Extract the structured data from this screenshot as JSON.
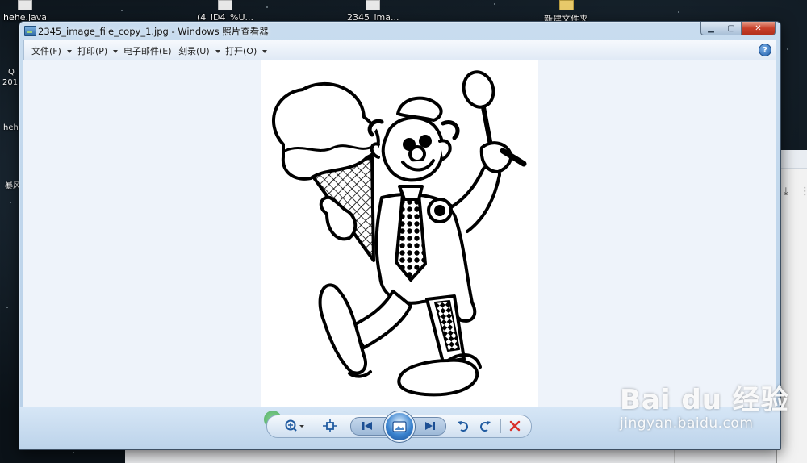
{
  "desktop": {
    "icons": [
      {
        "label": "hehe.java"
      },
      {
        "label": "(4_ID4_%U..."
      },
      {
        "label": "2345_ima..."
      },
      {
        "label": "新建文件夹"
      }
    ],
    "left_fragments": [
      "Q",
      "201",
      "hehe",
      "暴风"
    ]
  },
  "window": {
    "title": "2345_image_file_copy_1.jpg - Windows 照片查看器",
    "app_icon": "photo-viewer-icon",
    "caption_buttons": {
      "minimize": "minimize-icon",
      "maximize": "maximize-icon",
      "close": "close-icon"
    }
  },
  "menubar": {
    "items": [
      {
        "label": "文件(F)"
      },
      {
        "label": "打印(P)"
      },
      {
        "label": "电子邮件(E)"
      },
      {
        "label": "刻录(U)"
      },
      {
        "label": "打开(O)"
      }
    ],
    "help_icon": "help-icon",
    "help_label": "?"
  },
  "image": {
    "description_icon": "clown-ice-cream-cartoon"
  },
  "controls": {
    "zoom_icon": "zoom-icon",
    "fit_icon": "actual-size-icon",
    "prev_icon": "previous-icon",
    "slideshow_icon": "slideshow-icon",
    "next_icon": "next-icon",
    "rotate_ccw_icon": "rotate-counterclockwise-icon",
    "rotate_cw_icon": "rotate-clockwise-icon",
    "delete_icon": "delete-icon"
  },
  "watermark": {
    "logo": "Bai du 经验",
    "url": "jingyan.baidu.com"
  },
  "colors": {
    "window_frame": "#c8dcef",
    "viewer_bg": "#eef3fa",
    "close_button": "#c8402a",
    "delete_icon": "#d9302a"
  }
}
